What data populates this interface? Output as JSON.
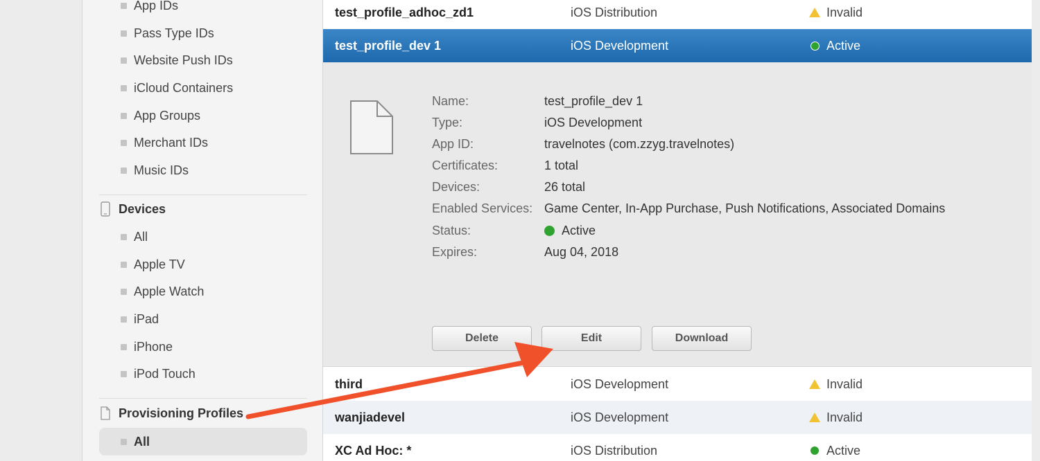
{
  "sidebar": {
    "identifiers": [
      "App IDs",
      "Pass Type IDs",
      "Website Push IDs",
      "iCloud Containers",
      "App Groups",
      "Merchant IDs",
      "Music IDs"
    ],
    "devices_section": {
      "title": "Devices",
      "icon": "iphone-icon"
    },
    "devices": [
      "All",
      "Apple TV",
      "Apple Watch",
      "iPad",
      "iPhone",
      "iPod Touch"
    ],
    "profiles_section": {
      "title": "Provisioning Profiles",
      "icon": "document-icon"
    },
    "profiles": [
      "All"
    ]
  },
  "profiles": [
    {
      "name": "test_profile_adhoc_zd1",
      "type": "iOS Distribution",
      "status": "Invalid",
      "status_icon": "warning-icon"
    },
    {
      "name": "test_profile_dev 1",
      "type": "iOS Development",
      "status": "Active",
      "status_icon": "green-dot-icon"
    },
    {
      "name": "third",
      "type": "iOS Development",
      "status": "Invalid",
      "status_icon": "warning-icon"
    },
    {
      "name": "wanjiadevel",
      "type": "iOS Development",
      "status": "Invalid",
      "status_icon": "warning-icon"
    },
    {
      "name": "XC Ad Hoc: *",
      "type": "iOS Distribution",
      "status": "Active",
      "status_icon": "green-dot-icon"
    }
  ],
  "detail": {
    "fields": [
      {
        "label": "Name:",
        "value": "test_profile_dev 1"
      },
      {
        "label": "Type:",
        "value": "iOS Development"
      },
      {
        "label": "App ID:",
        "value": "travelnotes (com.zzyg.travelnotes)"
      },
      {
        "label": "Certificates:",
        "value": "1 total"
      },
      {
        "label": "Devices:",
        "value": "26 total"
      },
      {
        "label": "Enabled Services:",
        "value": "Game Center, In-App Purchase, Push Notifications, Associated Domains"
      },
      {
        "label": "Status:",
        "value": "Active"
      },
      {
        "label": "Expires:",
        "value": "Aug 04, 2018"
      }
    ],
    "buttons": {
      "delete": "Delete",
      "edit": "Edit",
      "download": "Download"
    }
  },
  "colors": {
    "selected_row": "#1e69ad",
    "active": "#2fa32f",
    "warning": "#f1c232",
    "annotation_arrow": "#f0502a"
  }
}
